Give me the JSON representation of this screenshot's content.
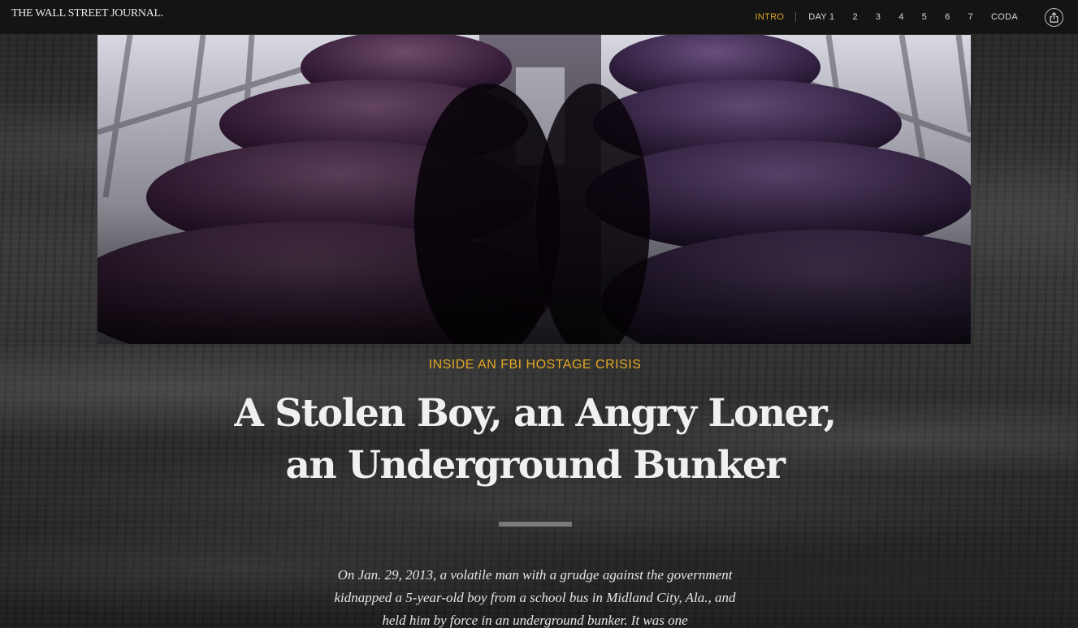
{
  "header": {
    "logo": "THE WALL STREET JOURNAL.",
    "nav": [
      {
        "label": "INTRO",
        "active": true
      },
      {
        "label": "DAY 1"
      },
      {
        "label": "2"
      },
      {
        "label": "3"
      },
      {
        "label": "4"
      },
      {
        "label": "5"
      },
      {
        "label": "6"
      },
      {
        "label": "7"
      },
      {
        "label": "CODA"
      }
    ],
    "share_icon": "share-icon"
  },
  "article": {
    "kicker": "INSIDE AN FBI HOSTAGE CRISIS",
    "headline": "A Stolen Boy, an Angry Loner, an Underground Bunker",
    "dek": "On Jan. 29, 2013, a volatile man with a grudge against the government kidnapped a 5-year-old boy from a school bus in Midland City, Ala., and held him by force in an underground bunker. It was one"
  },
  "colors": {
    "accent": "#e3a824",
    "topbar": "#141414",
    "text": "#f0f0f0"
  }
}
